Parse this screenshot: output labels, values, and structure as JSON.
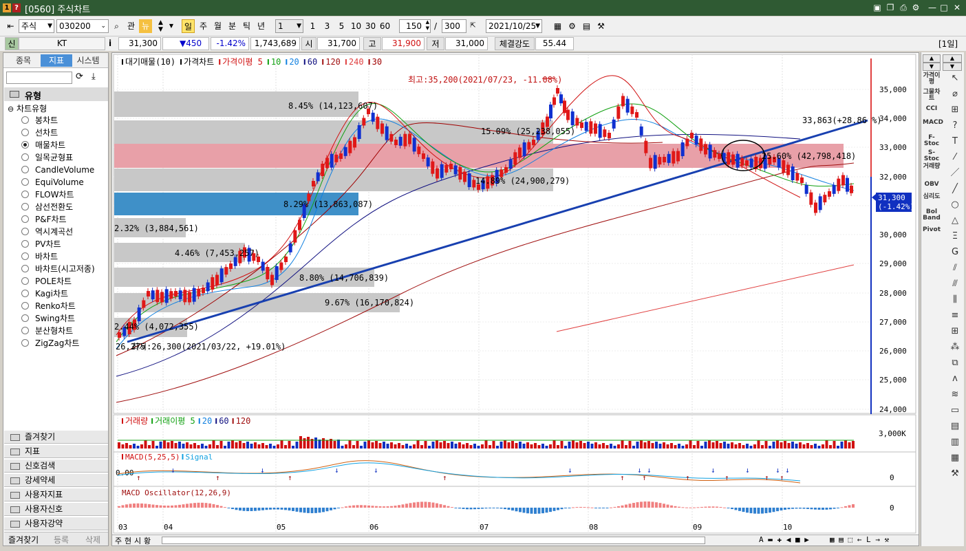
{
  "window": {
    "title": "[0560] 주식차트"
  },
  "toolbar": {
    "market": "주식",
    "code": "030200",
    "btn_gwan": "관",
    "btn_new": "뉴",
    "periods": [
      "일",
      "주",
      "월",
      "분",
      "틱",
      "년"
    ],
    "interval": "1",
    "quick": [
      "1",
      "3",
      "5",
      "10",
      "30",
      "60"
    ],
    "count": "150",
    "slash": "/",
    "total": "300",
    "date": "2021/10/25"
  },
  "quote": {
    "sin": "신",
    "name": "KT",
    "i": "i",
    "price": "31,300",
    "change": "▼450",
    "pct": "-1.42%",
    "volume": "1,743,689",
    "open_lbl": "시",
    "open": "31,700",
    "high_lbl": "고",
    "high": "31,900",
    "low_lbl": "저",
    "low": "31,000",
    "strength_lbl": "체결강도",
    "strength": "55.44",
    "period_badge": "[1일]"
  },
  "left": {
    "tabs": [
      "종목",
      "지표",
      "시스템"
    ],
    "section": "유형",
    "group": "차트유형",
    "types": [
      "봉차트",
      "선차트",
      "매물차트",
      "일목균형표",
      "CandleVolume",
      "EquiVolume",
      "FLOW차트",
      "삼선전환도",
      "P&F차트",
      "역시계곡선",
      "PV차트",
      "바차트",
      "바차트(시고저종)",
      "POLE차트",
      "Kagi차트",
      "Renko차트",
      "Swing차트",
      "분산형차트",
      "ZigZag차트"
    ],
    "selected": "매물차트",
    "accordion": [
      "즐겨찾기",
      "지표",
      "신호검색",
      "강세약세",
      "사용자지표",
      "사용자신호",
      "사용자강약"
    ],
    "bottom": [
      "즐겨찾기",
      "등록",
      "삭제"
    ]
  },
  "chart": {
    "legend": [
      {
        "text": "대기매물(10)",
        "color": "#000000"
      },
      {
        "text": "가격차트",
        "color": "#000000"
      },
      {
        "text": "가격이평 5",
        "color": "#d01010"
      },
      {
        "text": "10",
        "color": "#10a010"
      },
      {
        "text": "20",
        "color": "#1080e0"
      },
      {
        "text": "60",
        "color": "#101080"
      },
      {
        "text": "120",
        "color": "#a01010"
      },
      {
        "text": "240",
        "color": "#e04040"
      },
      {
        "text": "30",
        "color": "#a00000"
      }
    ],
    "price_axis": [
      "35,000",
      "34,000",
      "33,000",
      "32,000",
      "31,000",
      "30,000",
      "29,000",
      "28,000",
      "27,000",
      "26,000",
      "25,000",
      "24,000"
    ],
    "current": "31,300",
    "current_pct": "(-1.42%)",
    "high_note": "최고:35,200(2021/07/23, -11.08%)",
    "low_note": "최저:26,300(2021/03/22, +19.01%)",
    "trend_note": "33,863(+28.86 %)",
    "supply_labels": [
      "8.45% (14,123,607)",
      "15.09% (25,238,055)",
      "25.60% (42,798,418)",
      "14.89% (24,900,279)",
      "8.29% (13,863,087)",
      "2.32% (3,884,561)",
      "4.46% (7,453,257)",
      "8.80% (14,706,839)",
      "9.67% (16,170,824)",
      "2.44% (4,072,355)"
    ],
    "start_label": "26,275",
    "months": [
      "03",
      "04",
      "05",
      "06",
      "07",
      "08",
      "09",
      "10"
    ],
    "vol_legend": [
      {
        "text": "거래량",
        "color": "#d01010"
      },
      {
        "text": "거래이평 5",
        "color": "#10a010"
      },
      {
        "text": "20",
        "color": "#1080e0"
      },
      {
        "text": "60",
        "color": "#101080"
      },
      {
        "text": "120",
        "color": "#a01010"
      }
    ],
    "vol_axis": "3,000K",
    "macd_legend": [
      {
        "text": "MACD(5,25,5)",
        "color": "#d01010"
      },
      {
        "text": "Signal",
        "color": "#10a0e0"
      }
    ],
    "macd_zero": "0",
    "macd_val": "0.00",
    "osc_legend": [
      {
        "text": "MACD Oscillator(12,26,9)",
        "color": "#a01010"
      }
    ],
    "osc_zero": "0",
    "bottom_tabs": [
      "주",
      "현",
      "시",
      "황"
    ]
  },
  "rightbar": {
    "labels": [
      "가격이평",
      "그물차트",
      "CCI",
      "MACD",
      "F-Stoc",
      "S-Stoc",
      "거래량",
      "OBV",
      "심리도",
      "Bol Band",
      "Pivot"
    ]
  }
}
